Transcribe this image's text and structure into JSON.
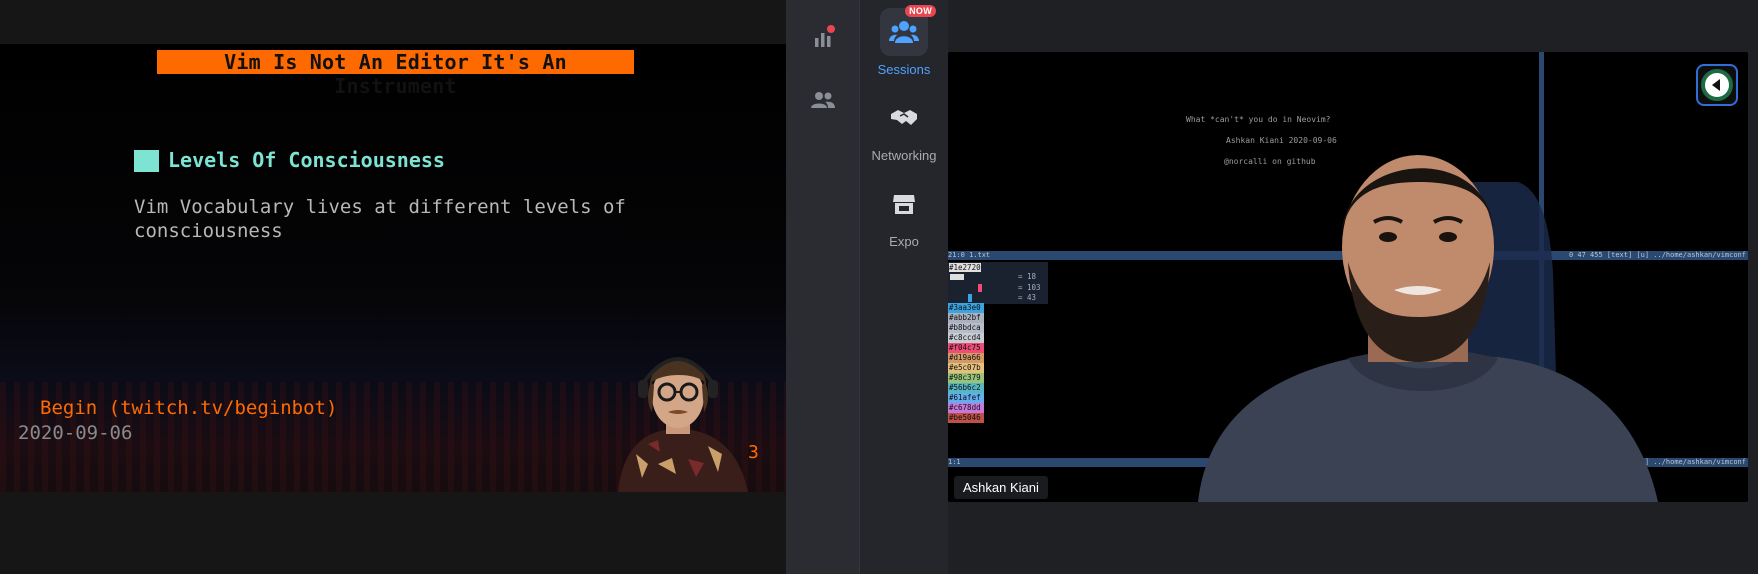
{
  "presentation": {
    "slide_title": "Vim Is Not An Editor It's An Instrument",
    "heading": "Levels Of Consciousness",
    "body_line1": "Vim Vocabulary lives at different levels of",
    "body_line2": "consciousness",
    "caption": "Begin (twitch.tv/beginbot)",
    "date": "2020-09-06",
    "trailing_number": "3"
  },
  "rail": {
    "icons": [
      "stats-icon",
      "people-icon"
    ]
  },
  "nav": {
    "items": [
      {
        "label": "Sessions",
        "icon": "sessions-icon",
        "badge": "NOW",
        "active": true
      },
      {
        "label": "Networking",
        "icon": "handshake-icon",
        "active": false
      },
      {
        "label": "Expo",
        "icon": "booth-icon",
        "active": false
      }
    ]
  },
  "speaker": {
    "name": "Ashkan Kiani",
    "terminal": {
      "line1": "What *can't* you do in Neovim?",
      "line2": "Ashkan Kiani 2020-09-06",
      "line3": "@norcalli on github",
      "status_top_left": "21:0 1.txt",
      "status_top_right": "0 47 455 [text] [u] ../home/ashkan/vimconf",
      "status_bottom_left": "1:1",
      "status_bottom_right": "23 1 All [u] ../home/ashkan/vimconf",
      "picker_hex": "#1e2720",
      "picker_values": [
        "= 18",
        "= 103",
        "= 43"
      ],
      "swatches": [
        "#3aa3e0",
        "#abb2bf",
        "#b8bdca",
        "#c8ccd4",
        "#f04c75",
        "#d19a66",
        "#e5c07b",
        "#98c379",
        "#56b6c2",
        "#61afef",
        "#c678dd",
        "#be5046"
      ]
    }
  },
  "colors": {
    "accent_orange": "#ff6a00",
    "teal": "#7de3d2",
    "nav_active": "#4da3ff",
    "badge": "#e8474f"
  }
}
